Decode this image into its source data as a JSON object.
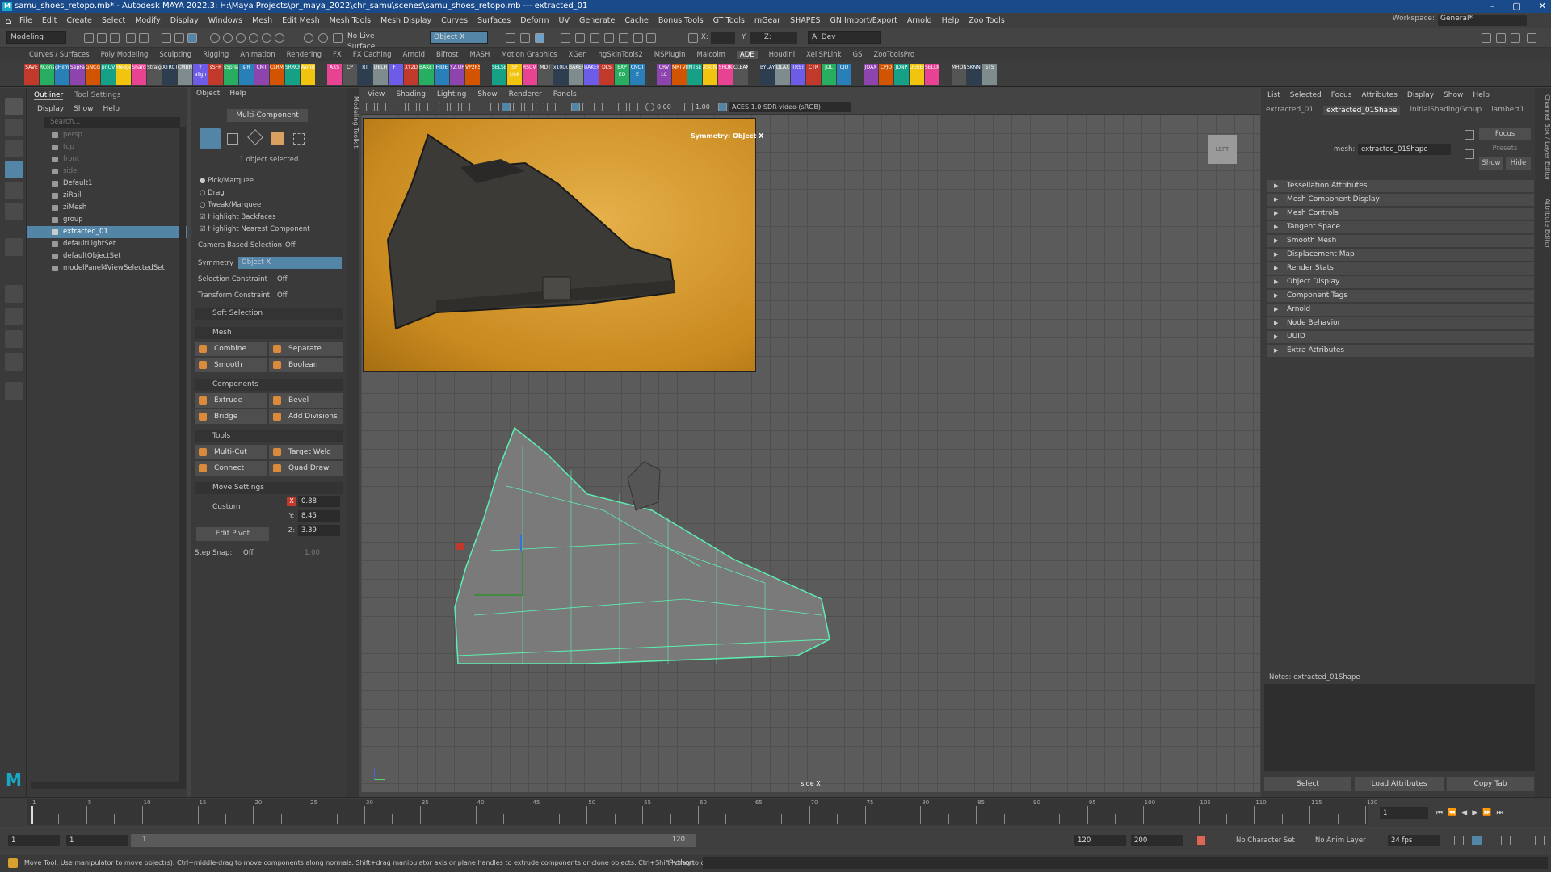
{
  "window": {
    "title": "samu_shoes_retopo.mb* - Autodesk MAYA 2022.3: H:\\Maya Projects\\pr_maya_2022\\chr_samu\\scenes\\samu_shoes_retopo.mb  ---  extracted_01",
    "controls": [
      "–",
      "▢",
      "✕"
    ]
  },
  "menus": [
    "File",
    "Edit",
    "Create",
    "Select",
    "Modify",
    "Display",
    "Windows",
    "Mesh",
    "Edit Mesh",
    "Mesh Tools",
    "Mesh Display",
    "Curves",
    "Surfaces",
    "Deform",
    "UV",
    "Generate",
    "Cache",
    "Bonus Tools",
    "GT Tools",
    "mGear",
    "SHAPES",
    "GN Import/Export",
    "Arnold",
    "Help",
    "Zoo Tools"
  ],
  "workspace": {
    "label": "Workspace:",
    "value": "General*"
  },
  "status": {
    "menuset": "Modeling",
    "live": "No Live Surface",
    "symmetry": "Object X",
    "x": "X:",
    "y": "Y:",
    "z": "Z:",
    "user": "A. Dev"
  },
  "shelf_tabs": [
    "Curves / Surfaces",
    "Poly Modeling",
    "Sculpting",
    "Rigging",
    "Animation",
    "Rendering",
    "FX",
    "FX Caching",
    "Arnold",
    "Bifrost",
    "MASH",
    "Motion Graphics",
    "XGen",
    "ngSkinTools2",
    "MSPlugin",
    "Malcolm",
    "ADE",
    "Houdini",
    "XeliSPLink",
    "GS",
    "ZooToolsPro"
  ],
  "shelf_active": "ADE",
  "shelf_labels": [
    "SAVE",
    "RConst",
    "gHilma",
    "SepFace",
    "GNCom",
    "priUV",
    "Hedges",
    "Shard",
    "Straight",
    "XTRCT",
    "CMBN",
    "Y align",
    "sSFR",
    "sSpread",
    "sIR",
    "CMT",
    "CLRMA",
    "SRRCH",
    "WorldFALGNO",
    "AXS",
    "CP",
    "RT",
    "DELH",
    "FT",
    "XY2D",
    "BAKET",
    "HIDE",
    "YZ.UP",
    "VP2RST",
    "SELSET",
    "SP Link",
    "RSUVT",
    "MDT",
    "x10Dup",
    "BAKEPJ",
    "BAKEPJ",
    "DLS",
    "EXP ED",
    "CNCT E",
    "CRV LC",
    "MRTVL",
    "INTSEL",
    "ASGNM",
    "SHDK",
    "CLEAN",
    "BYLAYR",
    "DLAX",
    "TRST",
    "CTR",
    "JDL",
    "CJO",
    "JOAX",
    "CPJO",
    "JDNP",
    "UEREF",
    "SELLM",
    "MHON",
    "SKNNR",
    "STS"
  ],
  "outliner": {
    "tabs": [
      "Outliner",
      "Tool Settings"
    ],
    "menu": [
      "Display",
      "Show",
      "Help"
    ],
    "search": "Search...",
    "items": [
      {
        "label": "persp",
        "dim": true
      },
      {
        "label": "top",
        "dim": true
      },
      {
        "label": "front",
        "dim": true
      },
      {
        "label": "side",
        "dim": true
      },
      {
        "label": "Default1"
      },
      {
        "label": "ziRail"
      },
      {
        "label": "ziMesh"
      },
      {
        "label": "group"
      },
      {
        "label": "extracted_01",
        "selected": true
      },
      {
        "label": "defaultLightSet"
      },
      {
        "label": "defaultObjectSet"
      },
      {
        "label": "modelPanel4ViewSelectedSet"
      }
    ]
  },
  "modeling_toolkit": {
    "menu": [
      "Object",
      "Help"
    ],
    "multi": "Multi-Component",
    "selected_count": "1 object selected",
    "radio": [
      "Pick/Marquee",
      "Drag",
      "Tweak/Marquee"
    ],
    "checks": [
      "Highlight Backfaces",
      "Highlight Nearest Component"
    ],
    "cbs_label": "Camera Based Selection",
    "cbs_value": "Off",
    "sym_label": "Symmetry",
    "sym_value": "Object X",
    "selc_label": "Selection Constraint",
    "selc_value": "Off",
    "tc_label": "Transform Constraint",
    "tc_value": "Off",
    "soft": "Soft Selection",
    "sec_mesh": "Mesh",
    "combine": "Combine",
    "separate": "Separate",
    "smooth": "Smooth",
    "boolean": "Boolean",
    "sec_comp": "Components",
    "extrude": "Extrude",
    "bevel": "Bevel",
    "bridge": "Bridge",
    "adddiv": "Add Divisions",
    "sec_tools": "Tools",
    "multicut": "Multi-Cut",
    "targetweld": "Target Weld",
    "connect": "Connect",
    "quaddraw": "Quad Draw",
    "sec_move": "Move Settings",
    "custom": "Custom",
    "x": "0.88",
    "y": "8.45",
    "z": "3.39",
    "editpivot": "Edit Pivot",
    "stepsnap": "Step Snap:",
    "stepsnap_val": "Off",
    "stepsnap_num": "1.00",
    "vertical": "Modeling Toolkit"
  },
  "viewport": {
    "menu": [
      "View",
      "Shading",
      "Lighting",
      "Show",
      "Renderer",
      "Panels"
    ],
    "exposure": "0.00",
    "gamma": "1.00",
    "colorspace": "ACES 1.0 SDR-video (sRGB)",
    "symmetry_hud": "Symmetry: Object X",
    "camera": "side X",
    "viewcube": "LEFT"
  },
  "attr_editor": {
    "menu": [
      "List",
      "Selected",
      "Focus",
      "Attributes",
      "Display",
      "Show",
      "Help"
    ],
    "tabs": [
      "extracted_01",
      "extracted_01Shape",
      "initialShadingGroup",
      "lambert1"
    ],
    "active_tab": "extracted_01Shape",
    "mesh_label": "mesh:",
    "mesh_value": "extracted_01Shape",
    "focus": "Focus",
    "presets": "Presets",
    "show": "Show",
    "hide": "Hide",
    "sections": [
      "Tessellation Attributes",
      "Mesh Component Display",
      "Mesh Controls",
      "Tangent Space",
      "Smooth Mesh",
      "Displacement Map",
      "Render Stats",
      "Object Display",
      "Component Tags",
      "Arnold",
      "Node Behavior",
      "UUID",
      "Extra Attributes"
    ],
    "notes": "Notes:  extracted_01Shape",
    "select": "Select",
    "load": "Load Attributes",
    "copytab": "Copy Tab",
    "vertical": "Attribute Editor",
    "vertical2": "Channel Box / Layer Editor"
  },
  "time": {
    "ticks": [
      "1",
      "",
      "5",
      "",
      "10",
      "",
      "15",
      "",
      "20",
      "",
      "25",
      "",
      "30",
      "",
      "35",
      "",
      "40",
      "",
      "45",
      "",
      "50",
      "",
      "55",
      "",
      "60",
      "",
      "65",
      "",
      "70",
      "",
      "75",
      "",
      "80",
      "",
      "85",
      "",
      "90",
      "",
      "95",
      "",
      "100",
      "",
      "105",
      "",
      "110",
      "",
      "115",
      "",
      "120"
    ],
    "current": "1"
  },
  "range": {
    "start": "1",
    "anim_start": "1",
    "range_start": "1",
    "range_end": "120",
    "anim_end": "120",
    "end": "200",
    "charset": "No Character Set",
    "animlayer": "No Anim Layer",
    "fps": "24 fps"
  },
  "help": {
    "text": "Move Tool: Use manipulator to move object(s). Ctrl+middle-drag to move components along normals. Shift+drag manipulator axis or plane handles to extrude components or clone objects. Ctrl+Shift+drag to constrain movement to a con",
    "python": "Python"
  }
}
